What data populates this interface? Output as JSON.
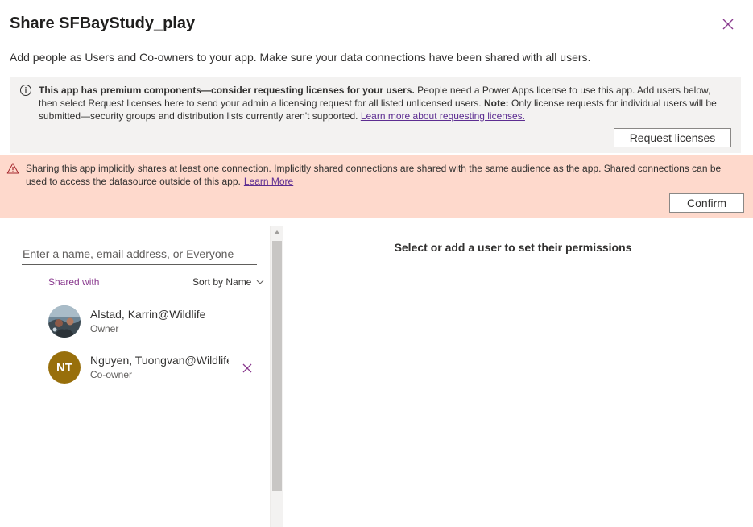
{
  "dialog": {
    "title": "Share SFBayStudy_play",
    "subtitle": "Add people as Users and Co-owners to your app. Make sure your data connections have been shared with all users."
  },
  "premium_notice": {
    "bold_lead": "This app has premium components—consider requesting licenses for your users.",
    "body": " People need a Power Apps license to use this app. Add users below, then select Request licenses here to send your admin a licensing request for all listed unlicensed users. ",
    "note_label": "Note:",
    "note_body": " Only license requests for individual users will be submitted—security groups and distribution lists currently aren't supported. ",
    "link": "Learn more about requesting licenses.",
    "button": "Request licenses",
    "icon": "info-icon"
  },
  "warning": {
    "text": "Sharing this app implicitly shares at least one connection. Implicitly shared connections are shared with the same audience as the app. Shared connections can be used to access the datasource outside of this app.",
    "link": "Learn More",
    "button": "Confirm",
    "icon": "warning-icon",
    "color": "#fed9cc"
  },
  "people_pane": {
    "search_placeholder": "Enter a name, email address, or Everyone",
    "shared_with_label": "Shared with",
    "sort_label": "Sort by Name",
    "users": [
      {
        "name": "Alstad, Karrin@Wildlife",
        "role": "Owner",
        "avatar": "photo"
      },
      {
        "name": "Nguyen, Tuongvan@Wildlife",
        "role": "Co-owner",
        "initials": "NT",
        "avatar_color": "#986f0b"
      }
    ]
  },
  "details_pane": {
    "placeholder": "Select or add a user to set their permissions"
  },
  "colors": {
    "accent": "#8a3b8f",
    "link": "#5c2d91"
  }
}
